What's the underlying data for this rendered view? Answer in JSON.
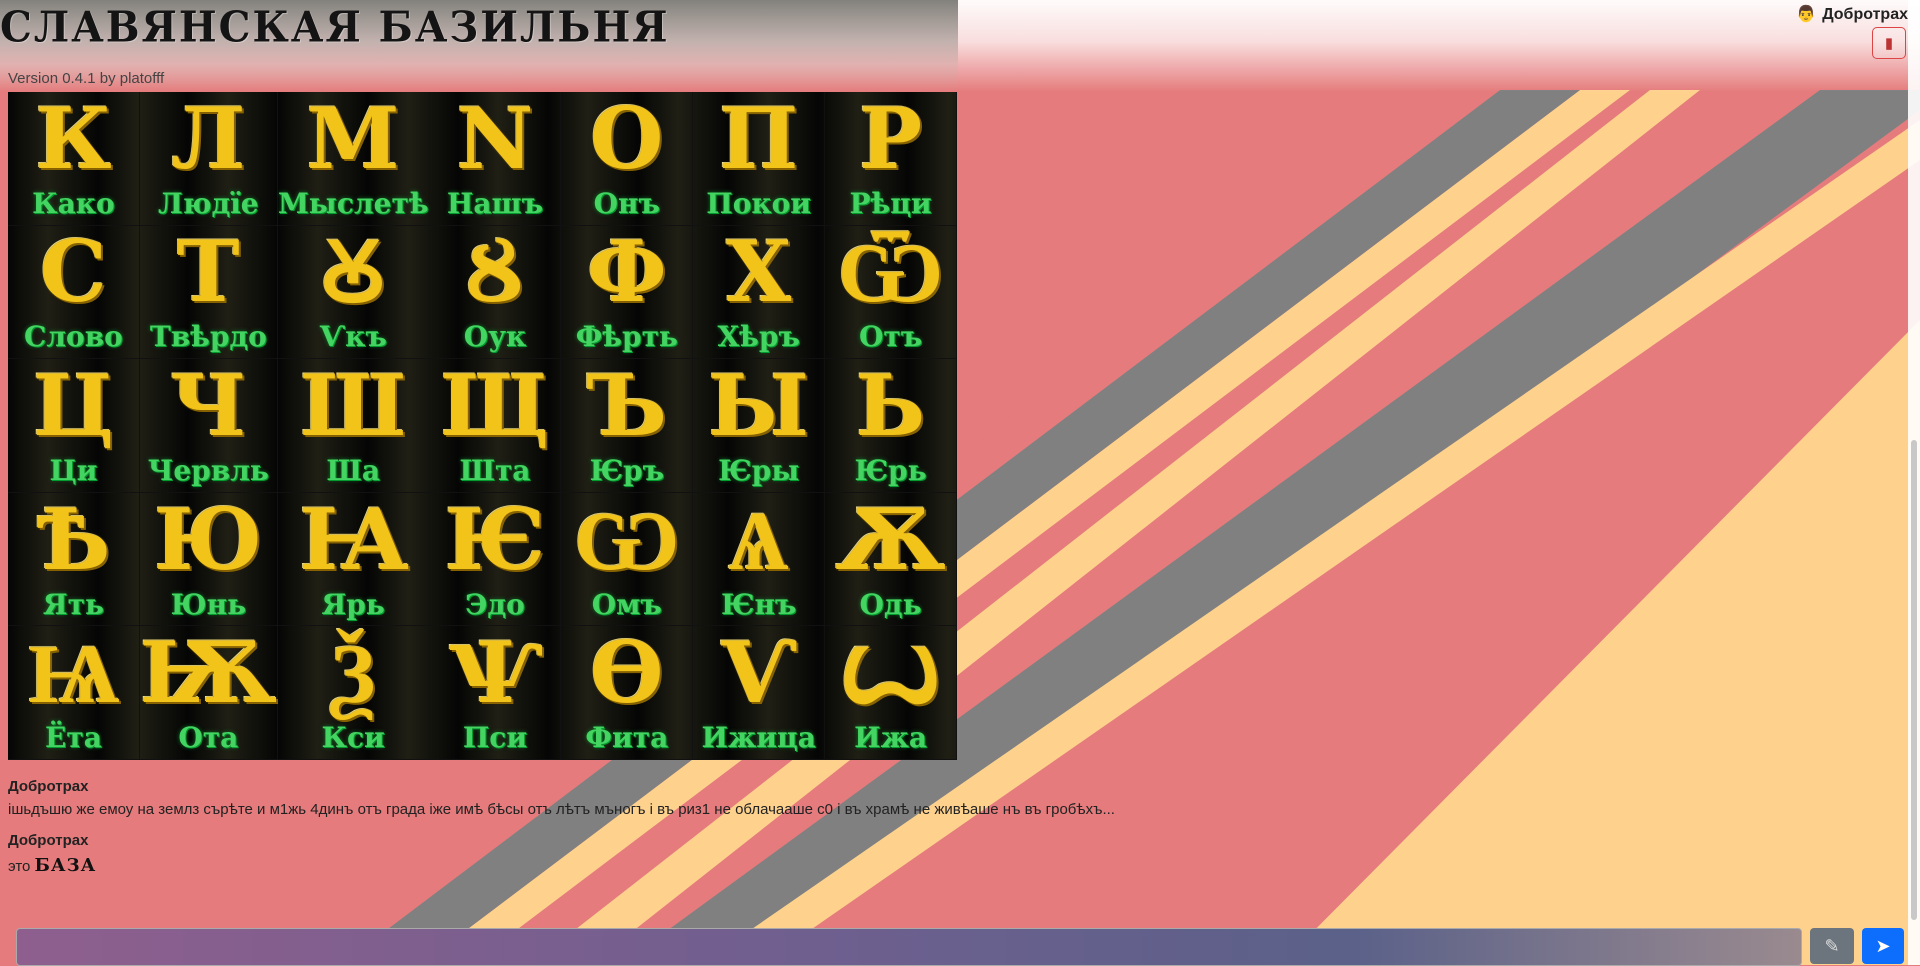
{
  "header": {
    "title": "СЛАВЯНСКАЯ БАЗИЛЬНЯ",
    "version": "Version 0.4.1 by platofff",
    "user_emoji": "👨",
    "user_name": "Добротрах",
    "logout_icon": "door-icon"
  },
  "alphabet": [
    {
      "glyph": "К",
      "name": "Како"
    },
    {
      "glyph": "Л",
      "name": "Людїе"
    },
    {
      "glyph": "М",
      "name": "Мыслетѣ"
    },
    {
      "glyph": "N",
      "name": "Нашъ"
    },
    {
      "glyph": "О",
      "name": "Онъ"
    },
    {
      "glyph": "П",
      "name": "Покои"
    },
    {
      "glyph": "Р",
      "name": "Рѣци"
    },
    {
      "glyph": "С",
      "name": "Слово"
    },
    {
      "glyph": "Т",
      "name": "Твѣрдо"
    },
    {
      "glyph": "Ꙋ",
      "name": "Ѵкъ"
    },
    {
      "glyph": "Ȣ",
      "name": "Оук"
    },
    {
      "glyph": "Ф",
      "name": "Фѣрть"
    },
    {
      "glyph": "Х",
      "name": "Хѣръ"
    },
    {
      "glyph": "Ѿ",
      "name": "Отъ"
    },
    {
      "glyph": "Ц",
      "name": "Ци"
    },
    {
      "glyph": "Ч",
      "name": "Червль"
    },
    {
      "glyph": "Ш",
      "name": "Ша"
    },
    {
      "glyph": "Щ",
      "name": "Шта"
    },
    {
      "glyph": "Ъ",
      "name": "Ѥръ"
    },
    {
      "glyph": "Ы",
      "name": "Ѥры"
    },
    {
      "glyph": "Ь",
      "name": "Ѥрь"
    },
    {
      "glyph": "Ѣ",
      "name": "Ять"
    },
    {
      "glyph": "Ю",
      "name": "Юнь"
    },
    {
      "glyph": "Ꙗ",
      "name": "Ярь"
    },
    {
      "glyph": "Ѥ",
      "name": "Эдо"
    },
    {
      "glyph": "Ѡ",
      "name": "Омъ"
    },
    {
      "glyph": "Ѧ",
      "name": "Ѥнъ"
    },
    {
      "glyph": "Ѫ",
      "name": "Одь"
    },
    {
      "glyph": "Ѩ",
      "name": "Ёта"
    },
    {
      "glyph": "Ѭ",
      "name": "Ота"
    },
    {
      "glyph": "Ѯ",
      "name": "Кси"
    },
    {
      "glyph": "Ѱ",
      "name": "Пси"
    },
    {
      "glyph": "Ѳ",
      "name": "Фита"
    },
    {
      "glyph": "Ѵ",
      "name": "Ижица"
    },
    {
      "glyph": "Ꙍ",
      "name": "Ижа"
    }
  ],
  "messages": [
    {
      "author": "Добротрах",
      "text": "ішьдъшю же емоу на землз сърѣте и м1жь 4динъ отъ града іже имѣ бѣсы отъ лѣтъ мъногъ і въ риз1 не облачааше с0 і въ храмѣ не живѣаше нъ въ гробѣхъ..."
    },
    {
      "author": "Добротрах",
      "text": "это",
      "emote": "БАЗА"
    }
  ],
  "composer": {
    "placeholder": "",
    "attach_icon": "paperclip-icon",
    "send_icon": "send-arrow-icon"
  },
  "colors": {
    "background_pink": "#e57b7c",
    "stripe_gray": "#808080",
    "stripe_peach": "#fed28d",
    "glyph_gold": "#f2c318",
    "glyph_name_green": "#44d461",
    "send_blue": "#0d6efd",
    "attach_gray": "#6c757d"
  }
}
